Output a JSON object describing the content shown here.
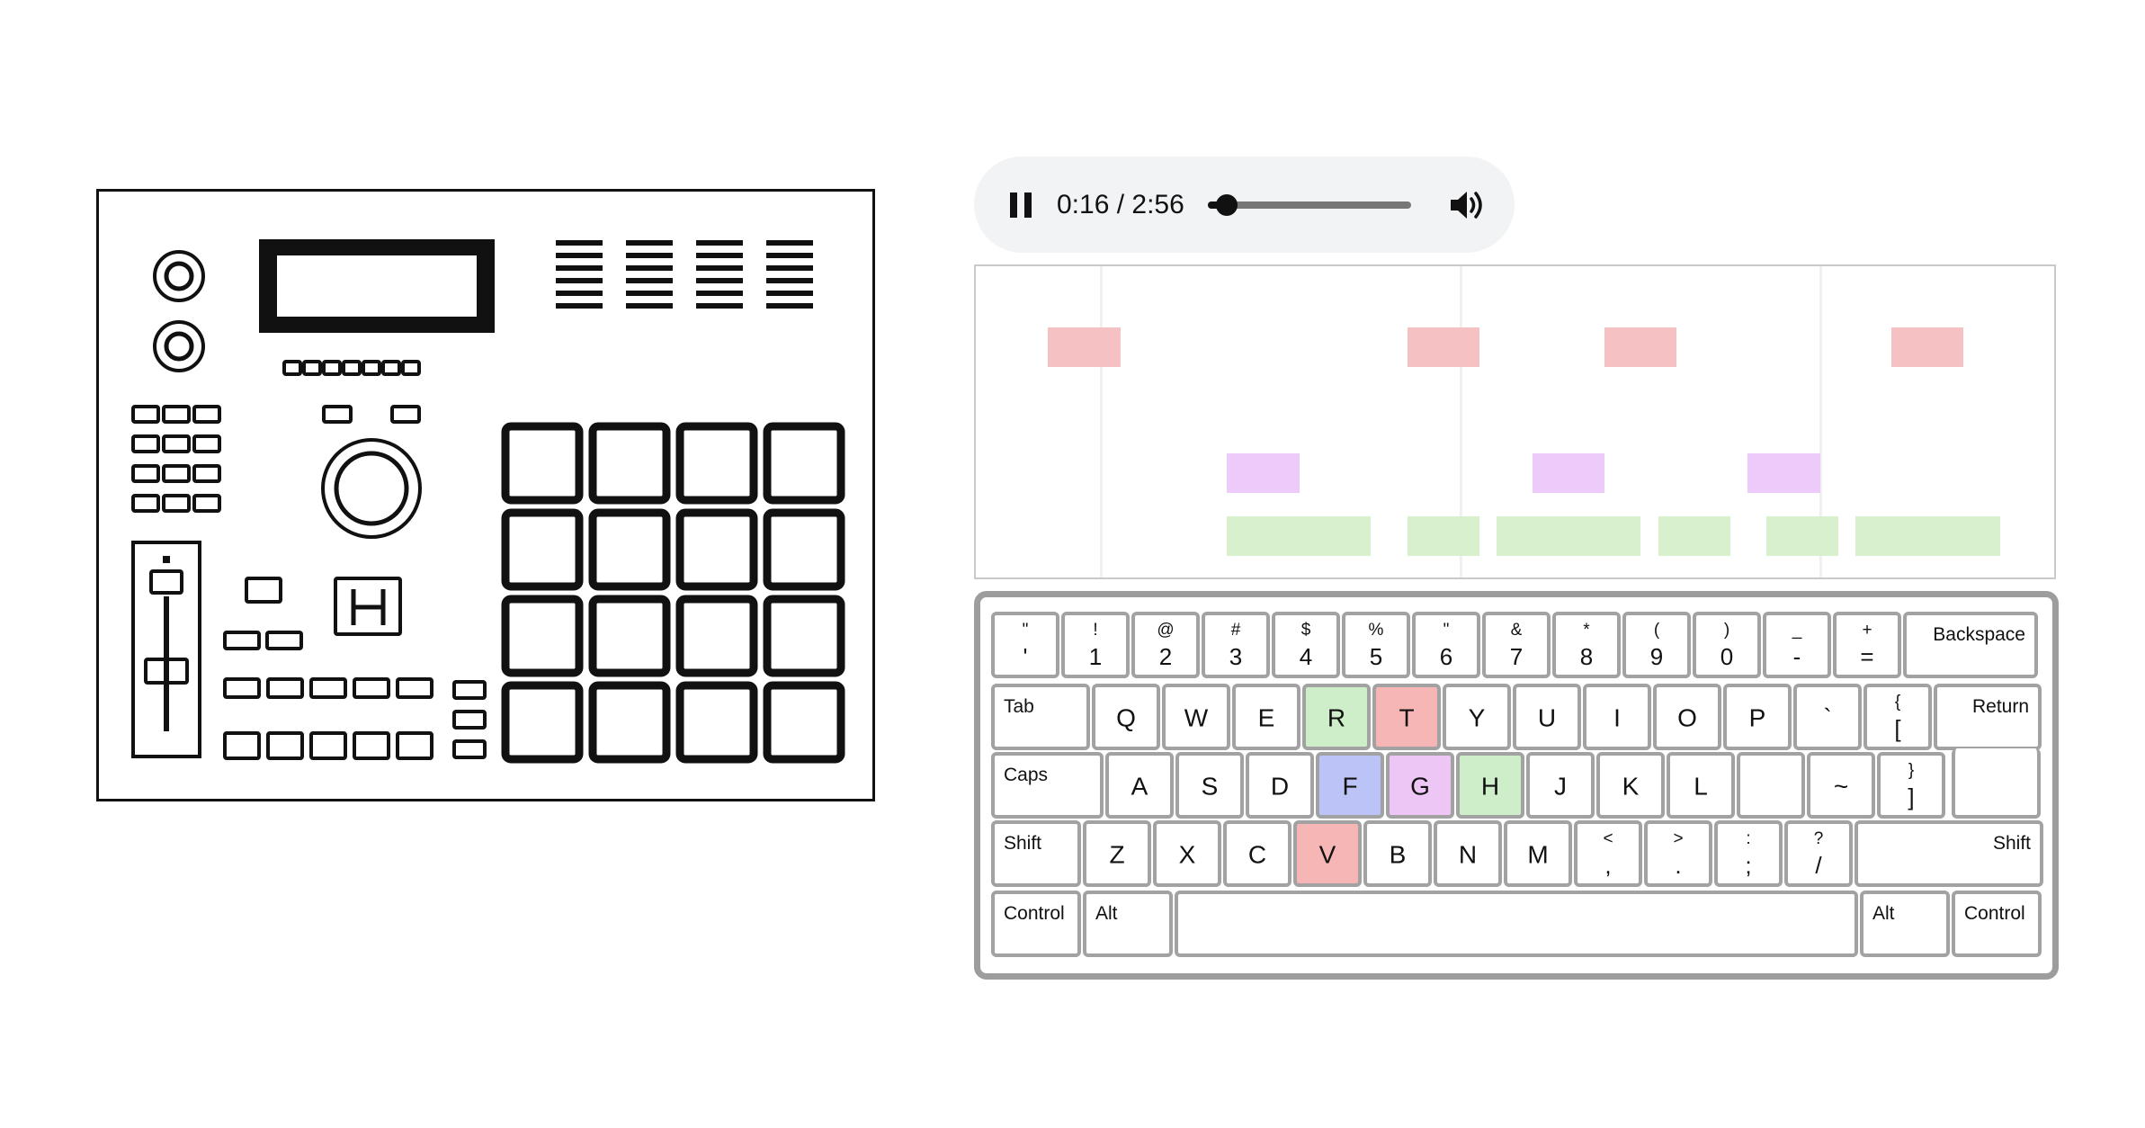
{
  "player": {
    "time_label": "0:16 / 2:56",
    "current_seconds": 16,
    "duration_seconds": 176,
    "state": "playing",
    "play_icon": "pause-icon",
    "volume_icon": "volume-icon"
  },
  "roll": {
    "colors": {
      "red": "#f6c1c3",
      "purple": "#eccafa",
      "green": "#d8f0cc"
    },
    "notes": [
      {
        "lane": "red",
        "start": 0.067,
        "end": 0.134
      },
      {
        "lane": "red",
        "start": 0.4,
        "end": 0.467
      },
      {
        "lane": "red",
        "start": 0.583,
        "end": 0.65
      },
      {
        "lane": "red",
        "start": 0.849,
        "end": 0.916
      },
      {
        "lane": "purple",
        "start": 0.233,
        "end": 0.3
      },
      {
        "lane": "purple",
        "start": 0.516,
        "end": 0.583
      },
      {
        "lane": "purple",
        "start": 0.716,
        "end": 0.783
      },
      {
        "lane": "green",
        "start": 0.233,
        "end": 0.366
      },
      {
        "lane": "green",
        "start": 0.4,
        "end": 0.467
      },
      {
        "lane": "green",
        "start": 0.483,
        "end": 0.616
      },
      {
        "lane": "green",
        "start": 0.633,
        "end": 0.7
      },
      {
        "lane": "green",
        "start": 0.733,
        "end": 0.8
      },
      {
        "lane": "green",
        "start": 0.816,
        "end": 0.95
      }
    ]
  },
  "keyboard": {
    "highlight_colors": {
      "red": "#f6b6b6",
      "green": "#cdeec8",
      "blue": "#bcc4f7",
      "purple": "#edc6f5"
    },
    "rows": [
      [
        {
          "main": "'",
          "shift": "\""
        },
        {
          "main": "1",
          "shift": "!"
        },
        {
          "main": "2",
          "shift": "@"
        },
        {
          "main": "3",
          "shift": "#"
        },
        {
          "main": "4",
          "shift": "$"
        },
        {
          "main": "5",
          "shift": "%"
        },
        {
          "main": "6",
          "shift": "\""
        },
        {
          "main": "7",
          "shift": "&"
        },
        {
          "main": "8",
          "shift": "*"
        },
        {
          "main": "9",
          "shift": "("
        },
        {
          "main": "0",
          "shift": ")"
        },
        {
          "main": "-",
          "shift": "_"
        },
        {
          "main": "=",
          "shift": "+"
        },
        {
          "main": "Backspace",
          "kind": "mod",
          "align": "right"
        }
      ],
      [
        {
          "main": "Tab",
          "kind": "mod"
        },
        {
          "main": "Q"
        },
        {
          "main": "W"
        },
        {
          "main": "E"
        },
        {
          "main": "R",
          "hl": "green"
        },
        {
          "main": "T",
          "hl": "red"
        },
        {
          "main": "Y"
        },
        {
          "main": "U"
        },
        {
          "main": "I"
        },
        {
          "main": "O"
        },
        {
          "main": "P"
        },
        {
          "main": "`"
        },
        {
          "main": "[",
          "shift": "{"
        },
        {
          "main": "Return",
          "kind": "mod",
          "align": "right"
        }
      ],
      [
        {
          "main": "Caps",
          "kind": "mod"
        },
        {
          "main": "A"
        },
        {
          "main": "S"
        },
        {
          "main": "D"
        },
        {
          "main": "F",
          "hl": "blue"
        },
        {
          "main": "G",
          "hl": "purple"
        },
        {
          "main": "H",
          "hl": "green"
        },
        {
          "main": "J"
        },
        {
          "main": "K"
        },
        {
          "main": "L"
        },
        {
          "main": ""
        },
        {
          "main": "~"
        },
        {
          "main": "]",
          "shift": "}"
        }
      ],
      [
        {
          "main": "Shift",
          "kind": "mod"
        },
        {
          "main": "Z"
        },
        {
          "main": "X"
        },
        {
          "main": "C"
        },
        {
          "main": "V",
          "hl": "red"
        },
        {
          "main": "B"
        },
        {
          "main": "N"
        },
        {
          "main": "M"
        },
        {
          "main": ",",
          "shift": "<"
        },
        {
          "main": ".",
          "shift": ">"
        },
        {
          "main": ";",
          "shift": ":"
        },
        {
          "main": "/",
          "shift": "?"
        },
        {
          "main": "Shift",
          "kind": "mod",
          "align": "right"
        }
      ],
      [
        {
          "main": "Control",
          "kind": "mod"
        },
        {
          "main": "Alt",
          "kind": "mod"
        },
        {
          "main": "",
          "kind": "space"
        },
        {
          "main": "Alt",
          "kind": "mod"
        },
        {
          "main": "Control",
          "kind": "mod"
        }
      ]
    ]
  }
}
